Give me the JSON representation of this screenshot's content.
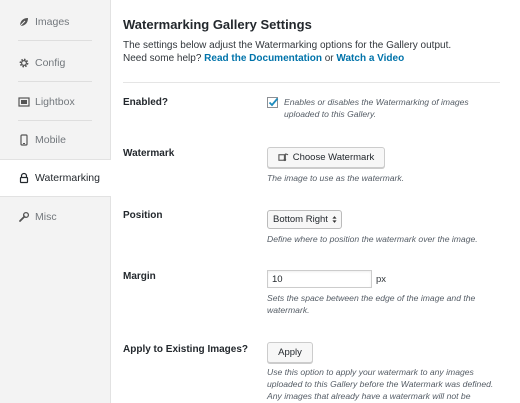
{
  "sidebar": {
    "items": [
      {
        "label": "Images",
        "icon": "leaf-icon"
      },
      {
        "label": "Config",
        "icon": "gear-icon"
      },
      {
        "label": "Lightbox",
        "icon": "gallery-icon"
      },
      {
        "label": "Mobile",
        "icon": "mobile-icon"
      },
      {
        "label": "Watermarking",
        "icon": "lock-icon",
        "active": true
      },
      {
        "label": "Misc",
        "icon": "wrench-icon"
      }
    ]
  },
  "main": {
    "title": "Watermarking Gallery Settings",
    "desc_line1": "The settings below adjust the Watermarking options for the Gallery output.",
    "desc_line2_prefix": "Need some help? ",
    "doc_link": "Read the Documentation",
    "or_text": " or ",
    "video_link": "Watch a Video"
  },
  "settings": {
    "enabled": {
      "label": "Enabled?",
      "checked": true,
      "help_line1": "Enables or disables the Watermarking of images",
      "help_line2": "uploaded to this Gallery."
    },
    "watermark": {
      "label": "Watermark",
      "button": "Choose Watermark",
      "help": "The image to use as the watermark."
    },
    "position": {
      "label": "Position",
      "selected": "Bottom Right",
      "help": "Define where to position the watermark over the image."
    },
    "margin": {
      "label": "Margin",
      "value": "10",
      "unit": "px",
      "help_line1": "Sets the space between the edge of the image and the",
      "help_line2": "watermark."
    },
    "apply": {
      "label": "Apply to Existing Images?",
      "button": "Apply",
      "help_line1": "Use this option to apply your watermark to any images",
      "help_line2": "uploaded to this Gallery before the Watermark was defined.",
      "help_line3": "Any images that already have a watermark will not be"
    }
  },
  "colors": {
    "accent": "#0073aa",
    "checkmark": "#1e8cbe"
  }
}
